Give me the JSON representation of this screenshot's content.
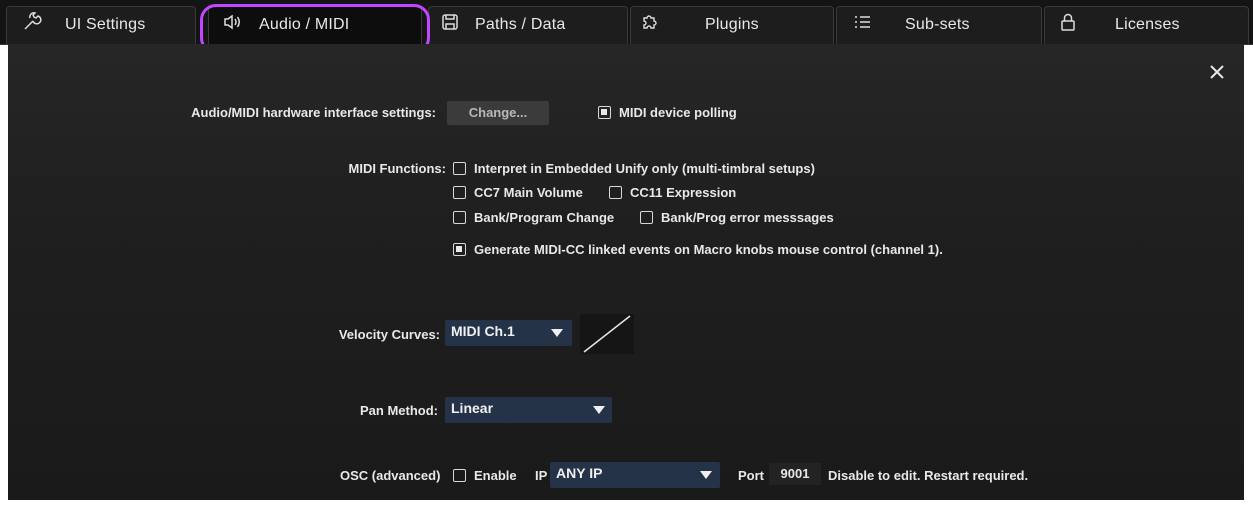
{
  "tabs": [
    {
      "label": "UI Settings",
      "icon": "wrench-icon"
    },
    {
      "label": "Audio / MIDI",
      "icon": "speaker-icon",
      "active": true
    },
    {
      "label": "Paths / Data",
      "icon": "save-icon"
    },
    {
      "label": "Plugins",
      "icon": "puzzle-icon"
    },
    {
      "label": "Sub-sets",
      "icon": "list-icon"
    },
    {
      "label": "Licenses",
      "icon": "lock-icon"
    }
  ],
  "highlight_color": "#c246ff",
  "hardware": {
    "label": "Audio/MIDI hardware interface settings:",
    "change_button": "Change...",
    "polling_label": "MIDI device polling",
    "polling_checked": true
  },
  "midi_functions": {
    "label": "MIDI Functions:",
    "options": [
      {
        "label": "Interpret in Embedded Unify only (multi-timbral setups)",
        "checked": false
      },
      {
        "label": "CC7 Main Volume",
        "checked": false
      },
      {
        "label": "CC11 Expression",
        "checked": false
      },
      {
        "label": "Bank/Program Change",
        "checked": false
      },
      {
        "label": "Bank/Prog error messsages",
        "checked": false
      },
      {
        "label": "Generate MIDI-CC linked events on Macro knobs mouse control (channel 1).",
        "checked": true
      }
    ]
  },
  "velocity": {
    "label": "Velocity Curves:",
    "value": "MIDI Ch.1"
  },
  "pan": {
    "label": "Pan Method:",
    "value": "Linear"
  },
  "osc": {
    "label": "OSC (advanced)",
    "enable_label": "Enable",
    "enable_checked": false,
    "ip_label": "IP",
    "ip_value": "ANY IP",
    "port_label": "Port",
    "port_value": "9001",
    "note": "Disable to edit. Restart required."
  },
  "colors": {
    "dropdown_bg": "#243347",
    "panel_bg": "#1f1f1f"
  }
}
